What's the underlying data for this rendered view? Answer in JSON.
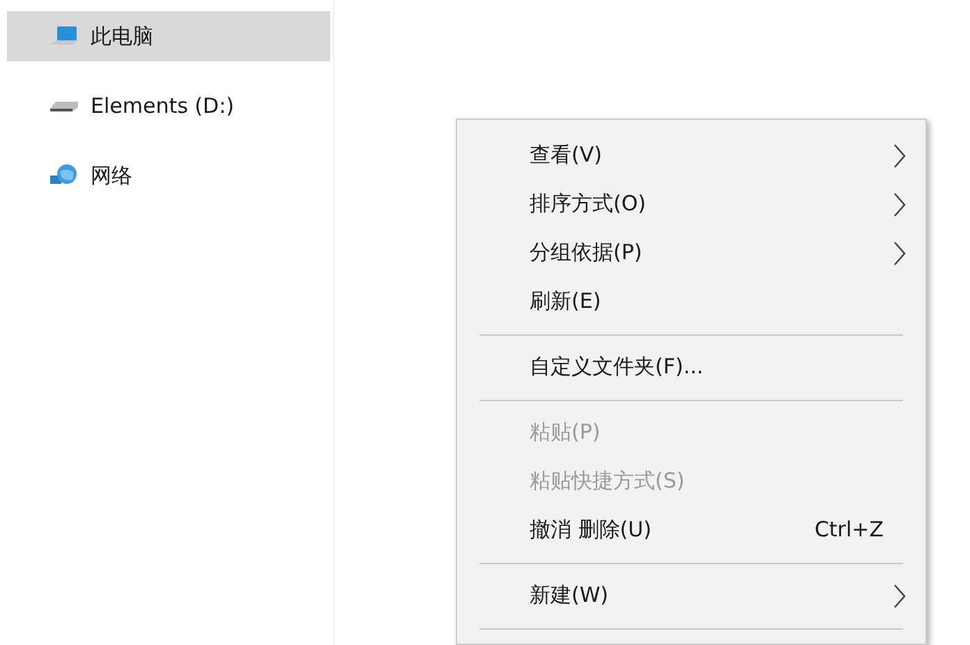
{
  "nav": [
    {
      "label": "此电脑",
      "kind": "computer",
      "selected": true
    },
    {
      "label": "Elements (D:)",
      "kind": "drive",
      "selected": false
    },
    {
      "label": "网络",
      "kind": "network",
      "selected": false
    }
  ],
  "context_menu": [
    {
      "kind": "item",
      "label": "查看(V)",
      "disabled": false,
      "submenu": true
    },
    {
      "kind": "item",
      "label": "排序方式(O)",
      "disabled": false,
      "submenu": true
    },
    {
      "kind": "item",
      "label": "分组依据(P)",
      "disabled": false,
      "submenu": true
    },
    {
      "kind": "item",
      "label": "刷新(E)",
      "disabled": false,
      "submenu": false
    },
    {
      "kind": "separator"
    },
    {
      "kind": "item",
      "label": "自定义文件夹(F)...",
      "disabled": false,
      "submenu": false
    },
    {
      "kind": "separator"
    },
    {
      "kind": "item",
      "label": "粘贴(P)",
      "disabled": true,
      "submenu": false
    },
    {
      "kind": "item",
      "label": "粘贴快捷方式(S)",
      "disabled": true,
      "submenu": false
    },
    {
      "kind": "item",
      "label": "撤消 删除(U)",
      "disabled": false,
      "submenu": false,
      "shortcut": "Ctrl+Z"
    },
    {
      "kind": "separator"
    },
    {
      "kind": "item",
      "label": "新建(W)",
      "disabled": false,
      "submenu": true
    },
    {
      "kind": "separator"
    }
  ]
}
